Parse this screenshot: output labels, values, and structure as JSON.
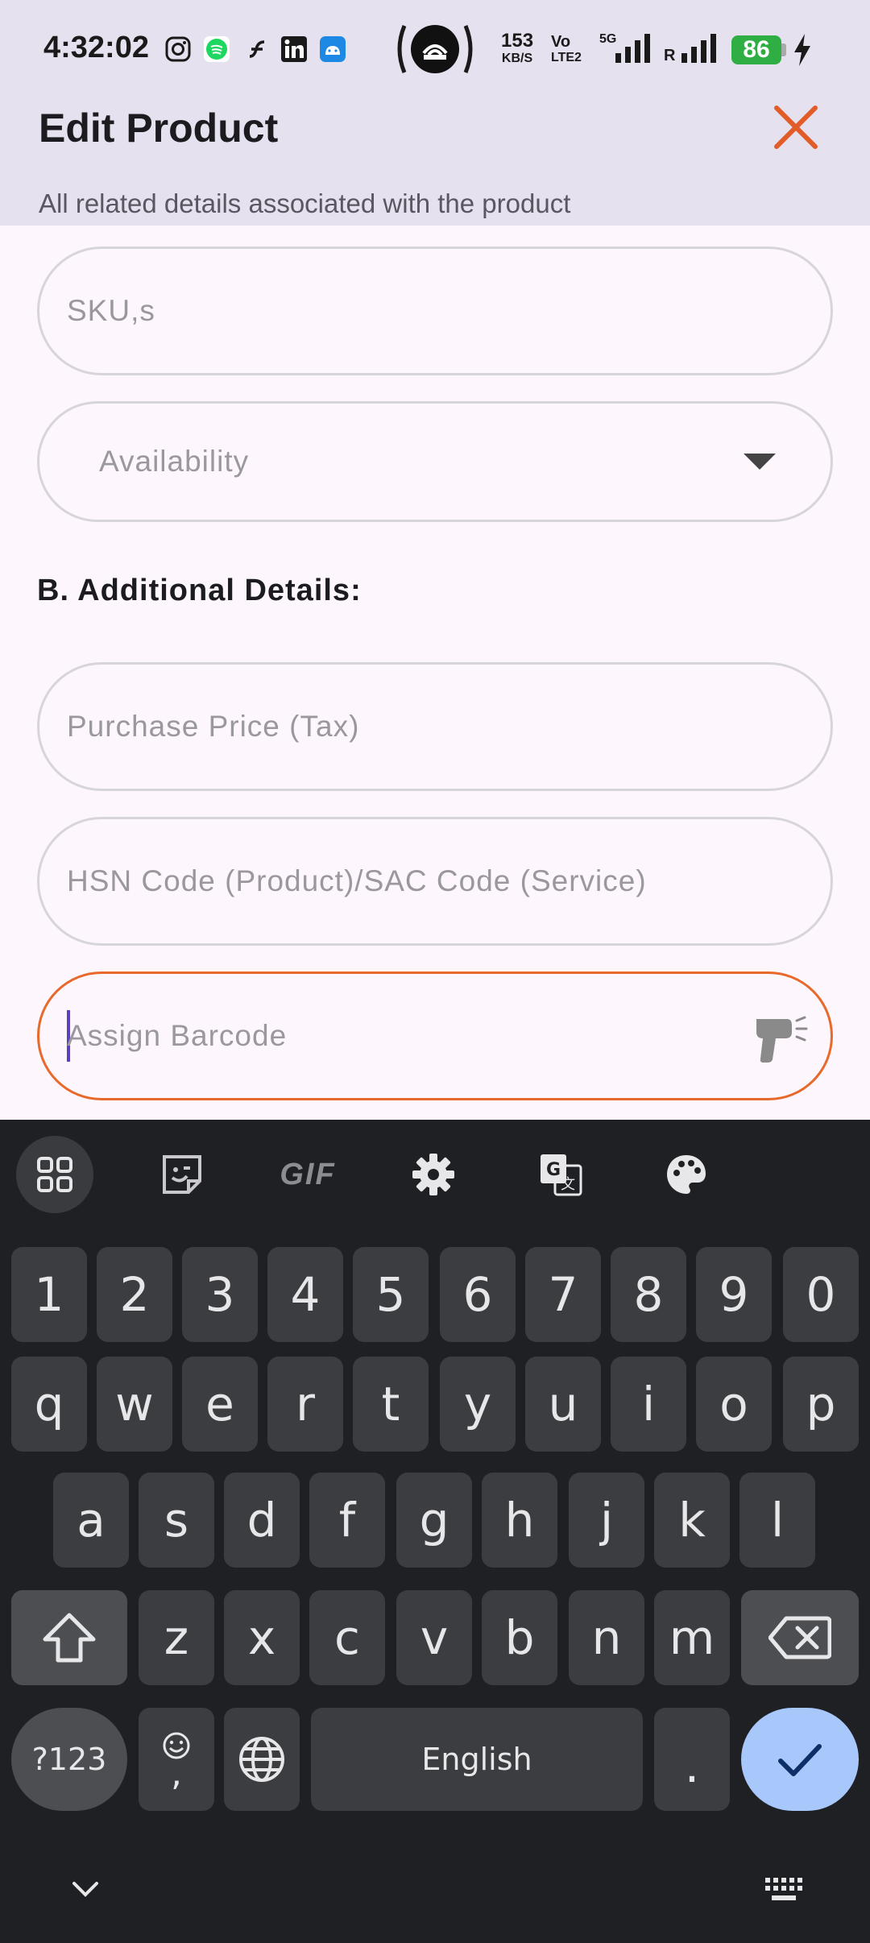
{
  "status_bar": {
    "time": "4:32:02",
    "net_speed_value": "153",
    "net_speed_unit": "KB/S",
    "volte_top": "Vo",
    "volte_bottom": "LTE2",
    "network": "5G",
    "roaming": "R",
    "battery": "86"
  },
  "header": {
    "title": "Edit Product",
    "subtitle": "All related details associated with the product"
  },
  "form": {
    "sku_placeholder": "SKU,s",
    "availability_placeholder": "Availability",
    "section_b_heading": "B. Additional Details:",
    "purchase_price_placeholder": "Purchase Price (Tax)",
    "hsn_placeholder": "HSN Code (Product)/SAC Code (Service)",
    "barcode_placeholder": "Assign Barcode"
  },
  "colors": {
    "accent": "#e8692c",
    "header_bg": "#e6e1ee",
    "page_bg": "#fdf7fd",
    "keyboard_bg": "#1f2023",
    "enter_key": "#a8c7fa"
  },
  "keyboard": {
    "toolbar": [
      "apps-grid-icon",
      "sticker-icon",
      "gif-icon",
      "settings-icon",
      "translate-icon",
      "palette-icon"
    ],
    "gif_label": "GIF",
    "row_numbers": [
      "1",
      "2",
      "3",
      "4",
      "5",
      "6",
      "7",
      "8",
      "9",
      "0"
    ],
    "row1": [
      "q",
      "w",
      "e",
      "r",
      "t",
      "y",
      "u",
      "i",
      "o",
      "p"
    ],
    "row2": [
      "a",
      "s",
      "d",
      "f",
      "g",
      "h",
      "j",
      "k",
      "l"
    ],
    "row3": [
      "z",
      "x",
      "c",
      "v",
      "b",
      "n",
      "m"
    ],
    "symbols_label": "?123",
    "comma_label": ",",
    "space_label": "English",
    "period_label": "."
  }
}
